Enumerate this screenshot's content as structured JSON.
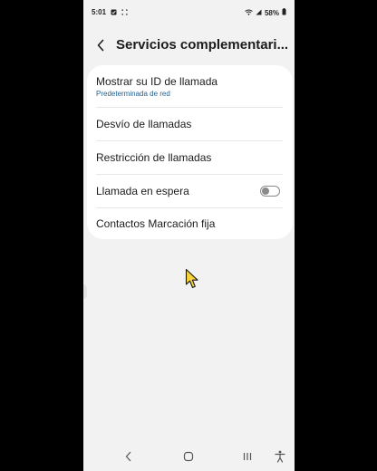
{
  "status_bar": {
    "time": "5:01",
    "battery": "58%",
    "icons": [
      "notification-check-icon",
      "bracket-icon",
      "wifi-icon",
      "signal-icon",
      "battery-icon"
    ]
  },
  "header": {
    "title": "Servicios complementari...",
    "back_icon": "chevron-left-icon"
  },
  "settings": [
    {
      "label": "Mostrar su ID de llamada",
      "sublabel": "Predeterminada de red"
    },
    {
      "label": "Desvío de llamadas"
    },
    {
      "label": "Restricción de llamadas"
    },
    {
      "label": "Llamada en espera",
      "toggle": false
    },
    {
      "label": "Contactos Marcación fija"
    }
  ],
  "nav_bar": {
    "icons": [
      "back-nav-icon",
      "home-nav-icon",
      "recents-nav-icon",
      "accessibility-icon"
    ]
  },
  "colors": {
    "background": "#f2f2f3",
    "card": "#ffffff",
    "subtext": "#245f8c",
    "text": "#1c1c1c"
  }
}
